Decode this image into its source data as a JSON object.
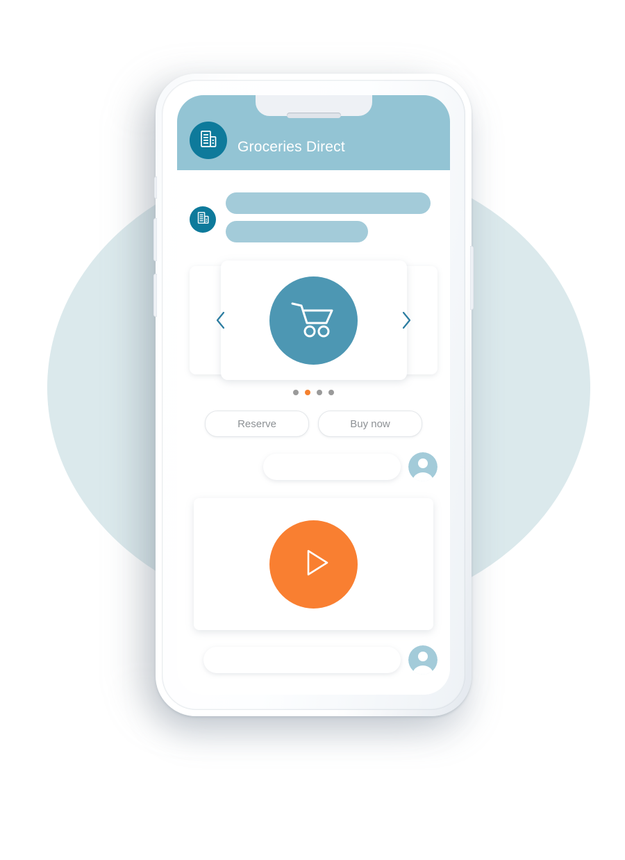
{
  "app": {
    "title": "Groceries Direct",
    "header_icon": "documents-icon",
    "header_bg": "#93c4d4",
    "brand_teal": "#0e7a9b",
    "accent_teal": "#4d97b3",
    "accent_orange": "#f97f31",
    "background_circle_color": "#dbe9ec"
  },
  "device": {
    "frame": "smartphone-mockup",
    "speaker_grill": "speaker-grill",
    "buttons": [
      "silent-switch",
      "volume-up-button",
      "volume-down-button",
      "power-button"
    ]
  },
  "conversation": {
    "bot_message": {
      "avatar_icon": "documents-icon",
      "placeholder_lines": 2
    },
    "carousel": {
      "prev_icon": "chevron-left-icon",
      "next_icon": "chevron-right-icon",
      "card_icon": "shopping-cart-icon",
      "dots_total": 4,
      "dots_active_index": 1,
      "dot_color": "#9a9a9a",
      "dot_active_color": "#f5812f"
    },
    "quick_replies": [
      {
        "label": "Reserve"
      },
      {
        "label": "Buy now"
      }
    ],
    "user_message_1": {
      "avatar_icon": "user-avatar-icon"
    },
    "video_card": {
      "play_icon": "play-icon"
    },
    "user_message_2": {
      "avatar_icon": "user-avatar-icon"
    }
  }
}
